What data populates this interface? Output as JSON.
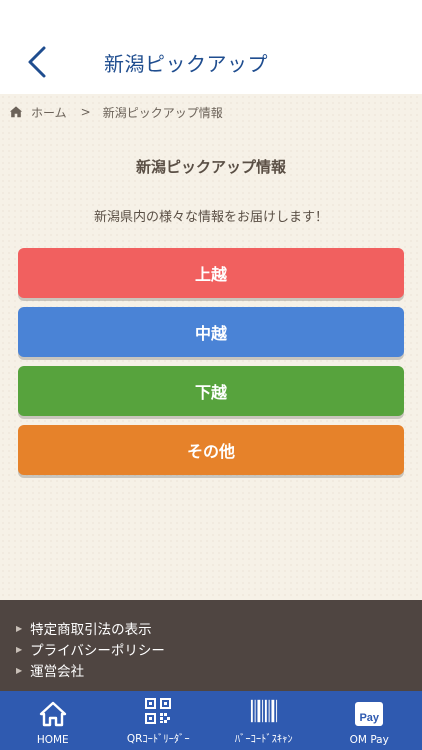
{
  "header": {
    "title": "新潟ピックアップ"
  },
  "breadcrumb": {
    "home": "ホーム",
    "separator": ">",
    "current": "新潟ピックアップ情報"
  },
  "main": {
    "title": "新潟ピックアップ情報",
    "description": "新潟県内の様々な情報をお届けします！",
    "buttons": [
      {
        "label": "上越",
        "color": "#f1605f"
      },
      {
        "label": "中越",
        "color": "#4a83d6"
      },
      {
        "label": "下越",
        "color": "#57a33d"
      },
      {
        "label": "その他",
        "color": "#e6822a"
      }
    ]
  },
  "footer": {
    "links": [
      "特定商取引法の表示",
      "プライバシーポリシー",
      "運営会社"
    ]
  },
  "tabbar": {
    "tabs": [
      {
        "label": "HOME",
        "icon": "home-icon"
      },
      {
        "label": "QRｺｰﾄﾞﾘｰﾀﾞｰ",
        "icon": "qr-code-icon"
      },
      {
        "label": "ﾊﾞｰｺｰﾄﾞｽｷｬﾝ",
        "icon": "barcode-icon"
      },
      {
        "label": "OM Pay",
        "icon": "pay-icon",
        "icon_text": "Pay"
      }
    ]
  },
  "colors": {
    "header_text": "#1f4d8f",
    "background": "#f6f1e7",
    "footer": "#4f4541",
    "tabbar": "#2f5ab0"
  }
}
